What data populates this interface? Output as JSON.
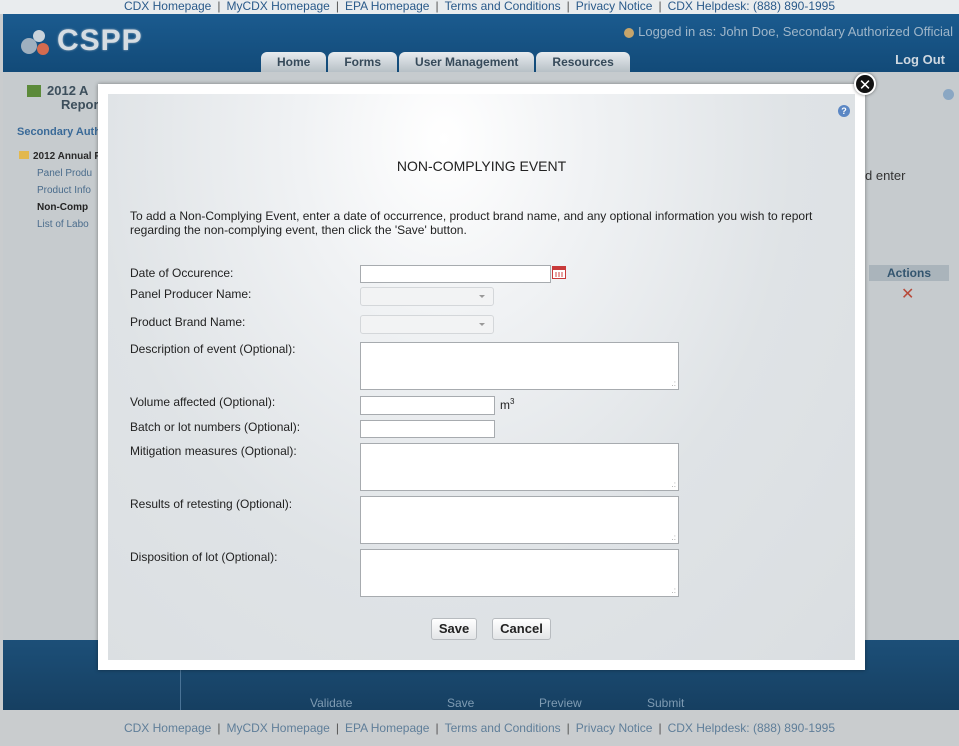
{
  "top_links": [
    "CDX Homepage",
    "MyCDX Homepage",
    "EPA Homepage",
    "Terms and Conditions",
    "Privacy Notice",
    "CDX Helpdesk: (888) 890-1995"
  ],
  "header": {
    "logo_text": "CSPP",
    "logged_in": "Logged in as: John Doe, Secondary Authorized Official",
    "logout": "Log Out",
    "tabs": [
      "Home",
      "Forms",
      "User Management",
      "Resources"
    ]
  },
  "background": {
    "title_line1": "2012 A",
    "title_line2": "Repor",
    "role": "Secondary Auth",
    "tree": {
      "root": "2012 Annual R",
      "items": [
        "Panel Produ",
        "Product Info",
        "Non-Comp",
        "List of Labo"
      ]
    },
    "enter_text": "d enter",
    "actions_header": "Actions"
  },
  "toolbar": {
    "validate": "Validate",
    "save": "Save",
    "preview": "Preview",
    "submit": "Submit"
  },
  "modal": {
    "title": "NON-COMPLYING EVENT",
    "instructions": "To add a Non-Complying Event, enter a date of occurrence, product brand name, and any optional information you wish to report regarding the non-complying event, then click the 'Save' button.",
    "fields": {
      "date_label": "Date of Occurence:",
      "date_value": "",
      "panel_producer_label": "Panel Producer Name:",
      "panel_producer_value": "",
      "product_brand_label": "Product Brand Name:",
      "product_brand_value": "",
      "description_label": "Description of event (Optional):",
      "volume_label": "Volume affected (Optional):",
      "volume_unit_base": "m",
      "volume_unit_exp": "3",
      "batch_label": "Batch or lot numbers (Optional):",
      "mitigation_label": "Mitigation measures (Optional):",
      "retesting_label": "Results of retesting (Optional):",
      "disposition_label": "Disposition of lot (Optional):"
    },
    "save_button": "Save",
    "cancel_button": "Cancel",
    "help_glyph": "?",
    "close_glyph": "✕"
  },
  "colors": {
    "header_blue": "#1b5b8f",
    "toolbar_blue": "#1c4f78",
    "link_blue": "#2a5a8a",
    "calendar_red": "#c83a3a"
  }
}
